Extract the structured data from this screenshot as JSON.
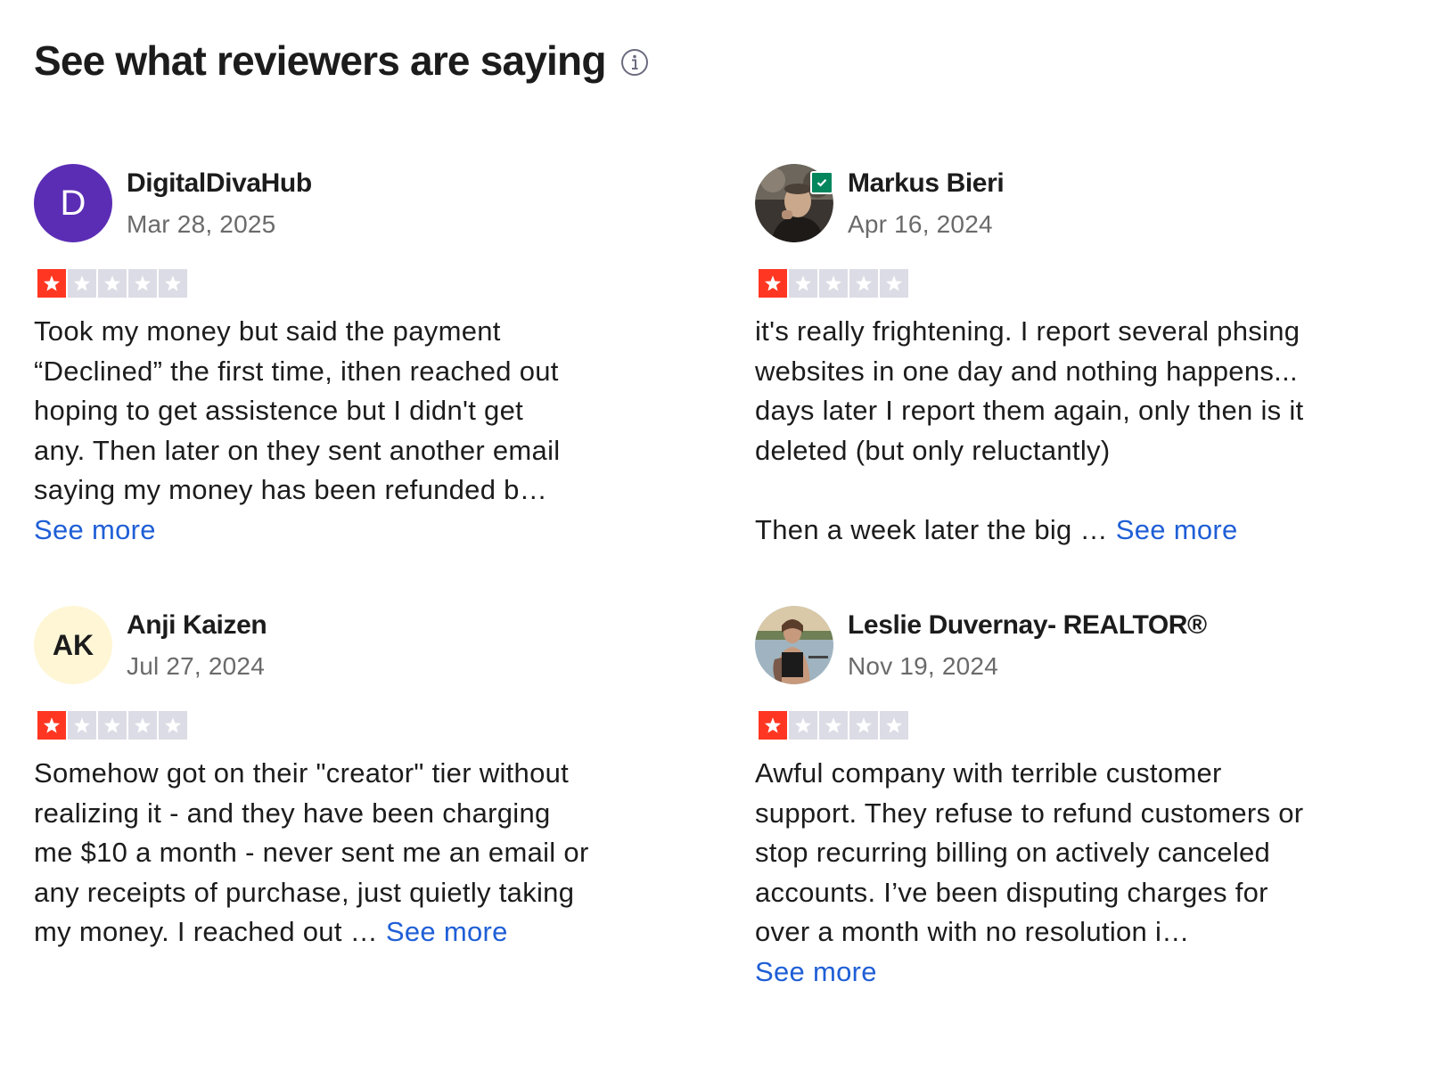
{
  "header": {
    "title": "See what reviewers are saying",
    "info_icon": "info-circle-icon"
  },
  "colors": {
    "star_filled": "#ff3722",
    "star_empty": "#dcdce6",
    "link": "#1f5fd6",
    "verified_badge": "#04865d"
  },
  "reviews": [
    {
      "name": "DigitalDivaHub",
      "date": "Mar 28, 2025",
      "avatar_initials": "D",
      "avatar_color": "#5b2db5",
      "rating": 1,
      "rating_max": 5,
      "text": "Took my money but said the payment\n“Declined” the first time, ithen reached out\nhoping to get assistence but I didn't get\nany. Then later on they sent another email\nsaying my money has been refunded b…",
      "see_more": "See more"
    },
    {
      "name": "Markus Bieri",
      "date": "Apr 16, 2024",
      "avatar_photo": "photo",
      "verified": true,
      "rating": 1,
      "rating_max": 5,
      "text": "it's really frightening. I report several phsing\nwebsites in one day and nothing happens...\ndays later I report them again, only then is it\ndeleted (but only reluctantly)\n\nThen a week later the big … ",
      "see_more": "See more"
    },
    {
      "name": "Anji Kaizen",
      "date": "Jul 27, 2024",
      "avatar_initials": "AK",
      "avatar_color": "#fff6d6",
      "rating": 1,
      "rating_max": 5,
      "text": "Somehow got on their \"creator\" tier without\nrealizing it - and they have been charging\nme $10 a month - never sent me an email or\nany receipts of purchase, just quietly taking\nmy money. I reached out … ",
      "see_more": "See more"
    },
    {
      "name": "Leslie Duvernay- REALTOR®",
      "date": "Nov 19, 2024",
      "avatar_photo": "photo",
      "rating": 1,
      "rating_max": 5,
      "text": "Awful company with terrible customer\nsupport. They refuse to refund customers or\nstop recurring billing on actively canceled\naccounts. I’ve been disputing charges for\nover a month with no resolution i…",
      "see_more": "See more"
    }
  ]
}
